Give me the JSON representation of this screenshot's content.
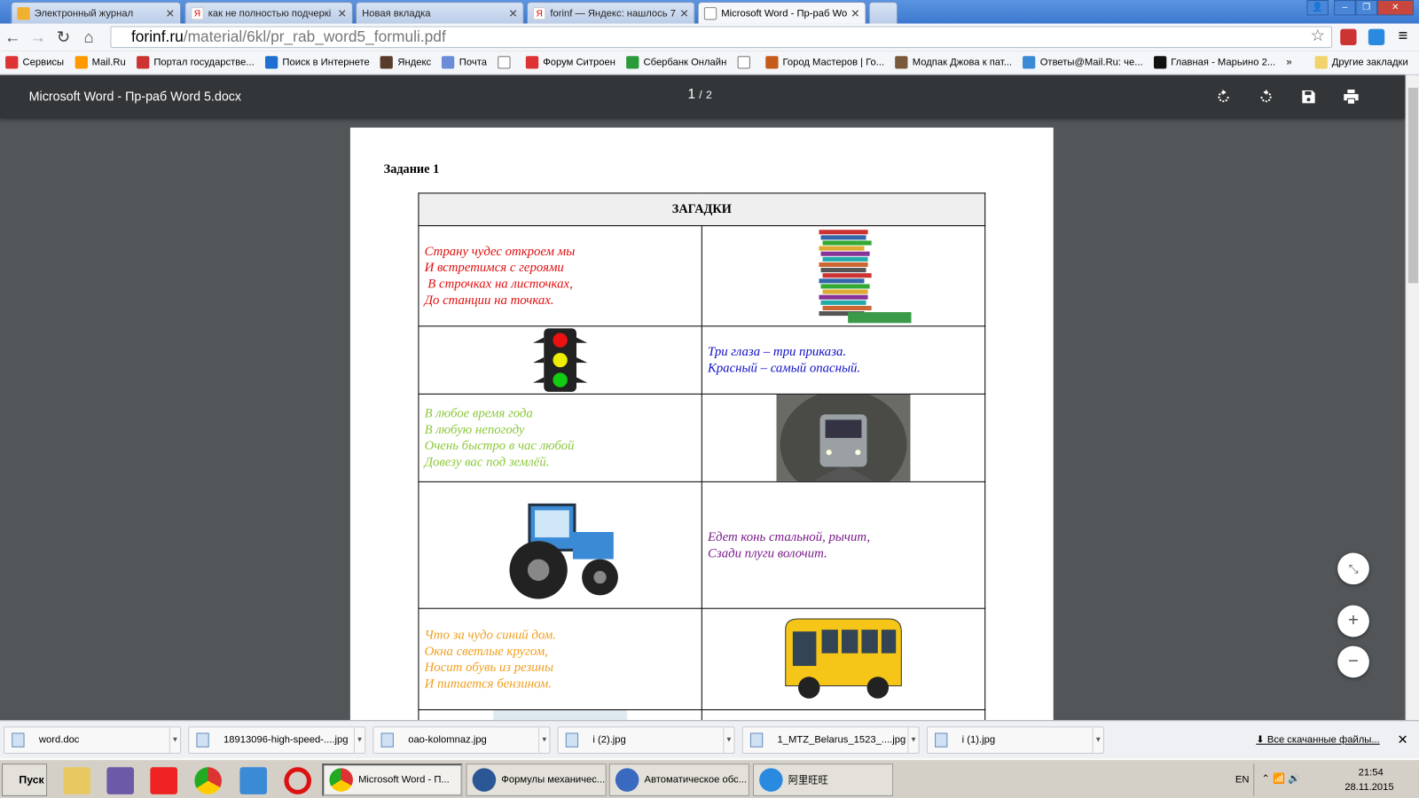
{
  "browser": {
    "tabs": [
      {
        "label": "Электронный журнал",
        "icon": "journal-icon"
      },
      {
        "label": "как не полностью подчеркі",
        "icon": "yandex-icon"
      },
      {
        "label": "Новая вкладка",
        "icon": "none"
      },
      {
        "label": "forinf — Яндекс: нашлось 7",
        "icon": "yandex-icon"
      },
      {
        "label": "Microsoft Word - Пр-раб Wor",
        "icon": "document-icon",
        "active": true
      }
    ],
    "url_host": "forinf.ru",
    "url_path": "/material/6kl/pr_rab_word5_formuli.pdf",
    "bookmarks": [
      {
        "label": "Сервисы",
        "color": "#d33"
      },
      {
        "label": "Mail.Ru",
        "color": "#f90"
      },
      {
        "label": "Портал государстве...",
        "color": "#c33"
      },
      {
        "label": "Поиск в Интернете",
        "color": "#1e6fd1"
      },
      {
        "label": "Яндекс",
        "color": "#5a3a2a"
      },
      {
        "label": "Почта",
        "color": "#6b8cd6"
      },
      {
        "label": "",
        "color": "#fff"
      },
      {
        "label": "Форум Ситроен",
        "color": "#d33"
      },
      {
        "label": "Сбербанк Онлайн",
        "color": "#2a9a3a"
      },
      {
        "label": "",
        "color": "#fff"
      },
      {
        "label": "Город Мастеров | Го...",
        "color": "#c55a1a"
      },
      {
        "label": "Модпак Джова к пат...",
        "color": "#7a5a3a"
      },
      {
        "label": "Ответы@Mail.Ru: че...",
        "color": "#3a8ad6"
      },
      {
        "label": "Главная - Марьино 2...",
        "color": "#111"
      }
    ],
    "more": "»",
    "other_bookmarks": "Другие закладки"
  },
  "pdf": {
    "title": "Microsoft Word - Пр-раб Word 5.docx",
    "page_current": "1",
    "page_sep": "/",
    "page_total": "2",
    "task": "Задание 1",
    "table_header": "ЗАГАДКИ",
    "riddles": [
      {
        "lines": [
          "Страну чудес откроем мы",
          "И встретимся с героями",
          " В строчках на листочках,",
          "До станции на точках."
        ],
        "color": "#e01010",
        "image": "books"
      },
      {
        "lines": [
          "Три глаза – три приказа.",
          "Красный – самый опасный."
        ],
        "color": "#1010c8",
        "image": "traffic-light"
      },
      {
        "lines": [
          "В любое время года",
          "В любую непогоду",
          "Очень быстро в час любой",
          "Довезу вас под землёй."
        ],
        "color": "#8cc83c",
        "image": "metro"
      },
      {
        "lines": [
          "Едет конь стальной, рычит,",
          "Сзади плуги волочит."
        ],
        "color": "#7a1a8a",
        "image": "tractor"
      },
      {
        "lines": [
          "Что за чудо синий дом.",
          "Окна светлые кругом,",
          "Носит обувь из резины",
          "И питается бензином."
        ],
        "color": "#f0a020",
        "image": "bus"
      }
    ]
  },
  "downloads": {
    "items": [
      "word.doc",
      "18913096-high-speed-....jpg",
      "oao-kolomnaz.jpg",
      "i (2).jpg",
      "1_MTZ_Belarus_1523_....jpg",
      "i (1).jpg"
    ],
    "all_label": "Все скачанные файлы..."
  },
  "taskbar": {
    "start": "Пуск",
    "windows": [
      "Microsoft Word - П...",
      "Формулы механичес...",
      "Автоматическое обс...",
      "阿里旺旺"
    ],
    "lang": "EN",
    "time": "21:54",
    "date": "28.11.2015"
  }
}
